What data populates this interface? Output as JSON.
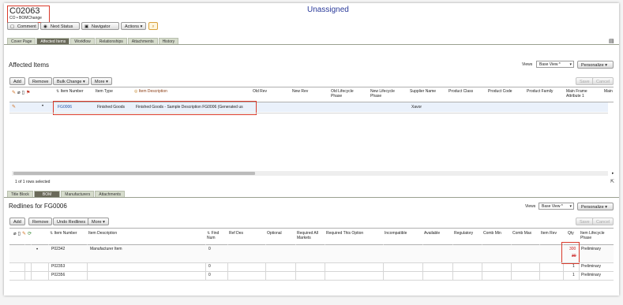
{
  "header": {
    "object_id": "C02063",
    "subtitle": "CO • BOMChange",
    "status": "Unassigned"
  },
  "toolbar": {
    "comment": "Comment",
    "next_status": "Next Status",
    "navigator": "Navigator",
    "actions": "Actions"
  },
  "top_tabs": [
    "Cover Page",
    "Affected Items",
    "Workflow",
    "Relationships",
    "Attachments",
    "History"
  ],
  "affected": {
    "title": "Affected Items",
    "views_label": "Views",
    "view_value": "Base View *",
    "personalize": "Personalize",
    "buttons": {
      "add": "Add",
      "remove": "Remove",
      "bulk_change": "Bulk Change",
      "more": "More",
      "save": "Save",
      "cancel": "Cancel"
    },
    "columns": [
      "Item Number",
      "Item Type",
      "Item Description",
      "Old Rev",
      "New Rev",
      "Old Lifecycle Phase",
      "New Lifecycle Phase",
      "Supplier Name",
      "Product Class",
      "Product Code",
      "Product Family",
      "Main Frame Attribute 1",
      "Main"
    ],
    "row": {
      "item_number": "FG0006",
      "item_type": "Finished Goods",
      "description": "Finished Goods - Sample Description FG0006 (Generated us",
      "supplier": "Xavor"
    },
    "rows_selected": "1 of 1 rows selected"
  },
  "bottom_tabs": [
    "Title Block",
    "BOM",
    "Manufacturers",
    "Attachments"
  ],
  "redlines": {
    "title": "Redlines for FG0006",
    "views_label": "Views",
    "view_value": "Base View *",
    "personalize": "Personalize",
    "buttons": {
      "add": "Add",
      "remove": "Remove",
      "undo_redlines": "Undo Redlines",
      "more": "More",
      "save": "Save",
      "cancel": "Cancel"
    },
    "columns": [
      "Item Number",
      "Item Description",
      "Find Num",
      "Ref Des",
      "Optional",
      "Required All Markets",
      "Required This Option",
      "Incompatible",
      "Available",
      "Regulatory",
      "Comb Min",
      "Comb Max",
      "Item Rev",
      "Qty",
      "Item Lifecycle Phase"
    ],
    "rows": [
      {
        "item_number": "P02342",
        "description": "Manufacturer Item",
        "find_num": "0",
        "qty_new": "300",
        "qty_old": "30",
        "phase": "Preliminary"
      },
      {
        "item_number": "P02353",
        "description": "",
        "find_num": "0",
        "qty": "1",
        "phase": "Preliminary"
      },
      {
        "item_number": "P02356",
        "description": "",
        "find_num": "0",
        "qty": "1",
        "phase": "Preliminary"
      }
    ]
  },
  "colors": {
    "accent": "#2a3a9a",
    "highlight": "#d93a2b",
    "link": "#2255aa",
    "redline": "#cc2222"
  }
}
